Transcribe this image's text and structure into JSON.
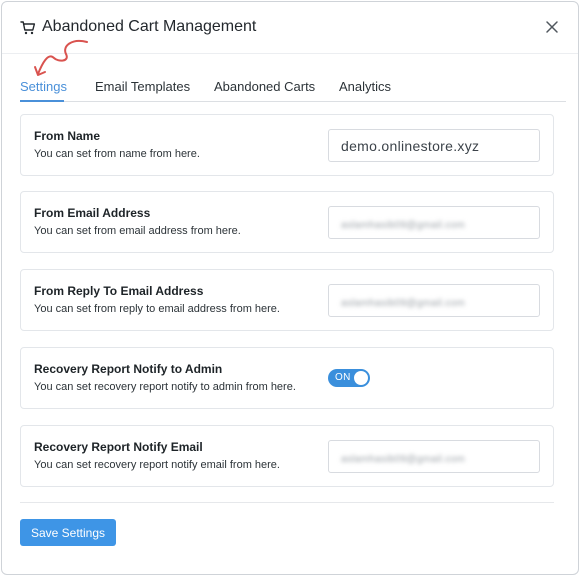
{
  "header": {
    "title": "Abandoned Cart Management",
    "icon": "cart-icon",
    "close_icon": "close-icon"
  },
  "tabs": [
    {
      "label": "Settings",
      "active": true
    },
    {
      "label": "Email Templates",
      "active": false
    },
    {
      "label": "Abandoned Carts",
      "active": false
    },
    {
      "label": "Analytics",
      "active": false
    }
  ],
  "settings": [
    {
      "label": "From Name",
      "description": "You can set from name from here.",
      "type": "input",
      "value": "demo.onlinestore.xyz"
    },
    {
      "label": "From Email Address",
      "description": "You can set from email address from here.",
      "type": "input",
      "value": "aslamhasib09@gmail.com"
    },
    {
      "label": "From Reply To Email Address",
      "description": "You can set from reply to email address from here.",
      "type": "input",
      "value": "aslamhasib09@gmail.com"
    },
    {
      "label": "Recovery Report Notify to Admin",
      "description": "You can set recovery report notify to admin from here.",
      "type": "toggle",
      "value": "ON"
    },
    {
      "label": "Recovery Report Notify Email",
      "description": "You can set recovery report notify email from here.",
      "type": "input",
      "value": "aslamhasib09@gmail.com"
    }
  ],
  "save_label": "Save Settings",
  "colors": {
    "accent": "#3e95e6",
    "annotation_arrow": "#d9534f"
  }
}
